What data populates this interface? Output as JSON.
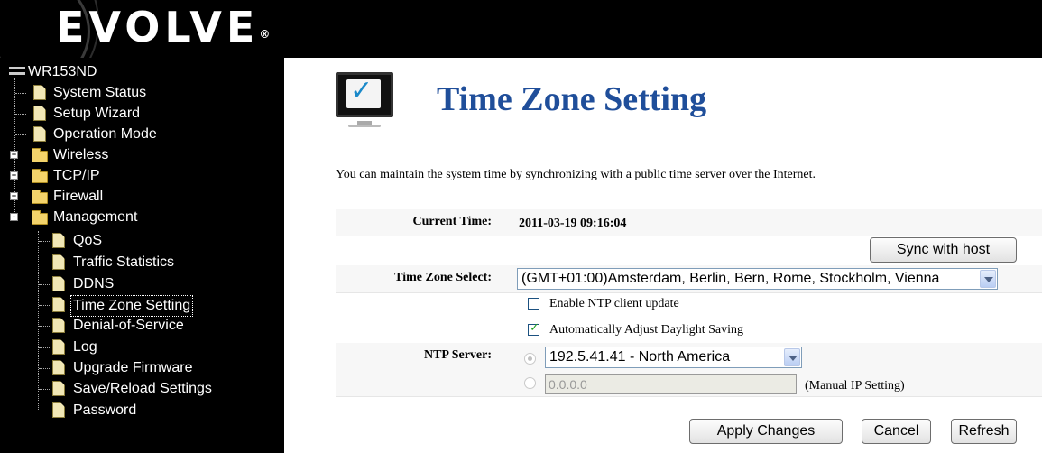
{
  "header": {
    "logo": "EVOLVE",
    "logo_mark": "®"
  },
  "sidebar": {
    "root": "WR153ND",
    "items": [
      {
        "label": "System Status"
      },
      {
        "label": "Setup Wizard"
      },
      {
        "label": "Operation Mode"
      },
      {
        "label": "Wireless",
        "expand": "+"
      },
      {
        "label": "TCP/IP",
        "expand": "+"
      },
      {
        "label": "Firewall",
        "expand": "+"
      },
      {
        "label": "Management",
        "expand": "-"
      }
    ],
    "management_items": [
      {
        "label": "QoS"
      },
      {
        "label": "Traffic Statistics"
      },
      {
        "label": "DDNS"
      },
      {
        "label": "Time Zone Setting",
        "selected": true
      },
      {
        "label": "Denial-of-Service"
      },
      {
        "label": "Log"
      },
      {
        "label": "Upgrade Firmware"
      },
      {
        "label": "Save/Reload Settings"
      },
      {
        "label": "Password"
      }
    ]
  },
  "main": {
    "title": "Time Zone Setting",
    "description": "You can maintain the system time by synchronizing with a public time server over the Internet.",
    "current_time_label": "Current Time:",
    "current_time_value": "2011-03-19 09:16:04",
    "sync_button": "Sync with host",
    "timezone_label": "Time Zone Select:",
    "timezone_value": "(GMT+01:00)Amsterdam, Berlin, Bern, Rome, Stockholm, Vienna",
    "ntp_enable_label": "Enable NTP client update",
    "ntp_enable_checked": false,
    "daylight_label": "Automatically Adjust Daylight Saving",
    "daylight_checked": true,
    "ntp_server_label": "NTP Server:",
    "ntp_server_value": "192.5.41.41 - North America",
    "manual_ip_placeholder": "0.0.0.0",
    "manual_ip_label": "(Manual IP Setting)",
    "apply_button": "Apply Changes",
    "cancel_button": "Cancel",
    "refresh_button": "Refresh"
  },
  "colors": {
    "title": "#1f4e9a",
    "accent_check": "#21a121"
  }
}
